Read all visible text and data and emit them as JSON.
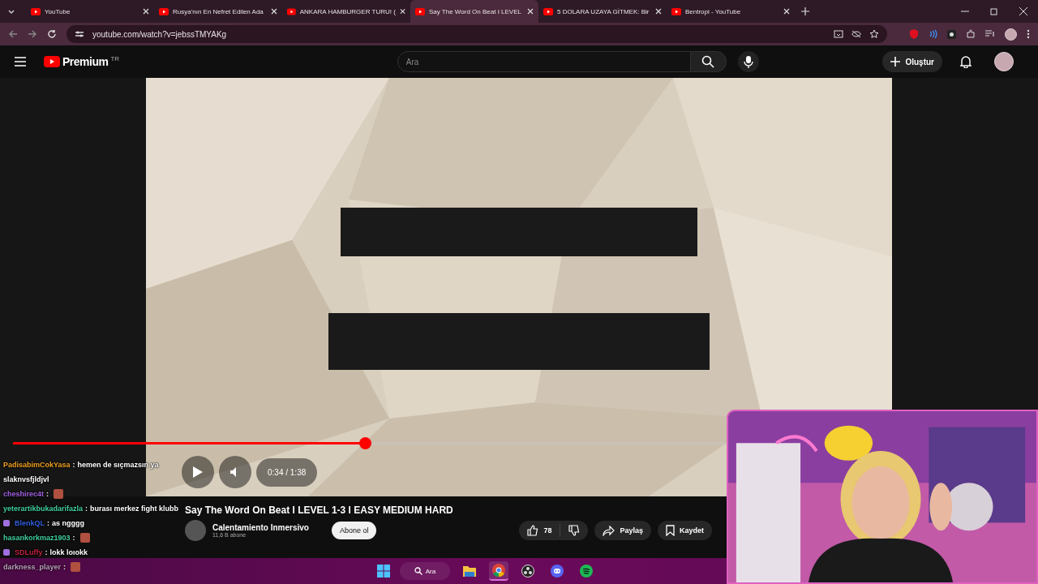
{
  "tabs": [
    {
      "title": "YouTube",
      "selected": false
    },
    {
      "title": "Rusya'nın En Nefret Edilen Ada",
      "selected": false
    },
    {
      "title": "ANKARA HAMBURGER TURU! (",
      "selected": false
    },
    {
      "title": "Say The Word On Beat I LEVEL",
      "selected": true
    },
    {
      "title": "5 DOLARA UZAYA GİTMEK: Bir",
      "selected": false
    },
    {
      "title": "Bentropi - YouTube",
      "selected": false
    }
  ],
  "address": {
    "url": "youtube.com/watch?v=jebssTMYAKg"
  },
  "youtube": {
    "logo": "Premium",
    "region": "TR",
    "search": {
      "placeholder": "Ara"
    },
    "create_button": "Oluştur"
  },
  "player": {
    "time": "0:34 / 1:38",
    "progress": {
      "level": 0.494
    }
  },
  "video": {
    "title": "Say The Word On Beat I LEVEL 1-3 I EASY MEDIUM HARD",
    "channel": "Calentamiento Inmersivo",
    "subscribers": "11,6 B abone",
    "subscribe_button": "Abone ol",
    "likes": "78",
    "share_button": "Paylaş",
    "save_button": "Kaydet"
  },
  "chat": [
    {
      "user": "PadisabimCokYasa",
      "color": "#f0a020",
      "separator": ":",
      "text": "hemen de sıçmazsın ya",
      "badge": false,
      "emote": false
    },
    {
      "text": "slaknvsfjldjvl",
      "badge": false,
      "emote": false
    },
    {
      "user": "cheshirec4t",
      "color": "#a060e0",
      "separator": ":",
      "badge": false,
      "emote": true
    },
    {
      "user": "yeterartikbukadarifazla",
      "color": "#40d0a0",
      "separator": ":",
      "text": "burası merkez fight klubb",
      "badge": false,
      "emote": false
    },
    {
      "user": "BlenkQL",
      "color": "#3060e0",
      "separator": ":",
      "text": "as ngggg",
      "badge": true,
      "emote": false
    },
    {
      "user": "hasankorkmaz1903",
      "color": "#40d0a0",
      "separator": ":",
      "badge": false,
      "emote": true
    },
    {
      "user": "SDLuffy",
      "color": "#c02040",
      "separator": ":",
      "text": "lokk loıokk",
      "badge": true,
      "emote": false
    },
    {
      "user": "darkness_player",
      "color": "#c0a0c0",
      "separator": ":",
      "badge": false,
      "emote": true
    }
  ],
  "taskbar": {
    "search_placeholder": "Ara",
    "apps": [
      {
        "kind": "files",
        "active": false
      },
      {
        "kind": "chrome",
        "active": true
      },
      {
        "kind": "obs",
        "active": false
      },
      {
        "kind": "discord",
        "active": false
      },
      {
        "kind": "spotify",
        "active": false
      }
    ]
  }
}
